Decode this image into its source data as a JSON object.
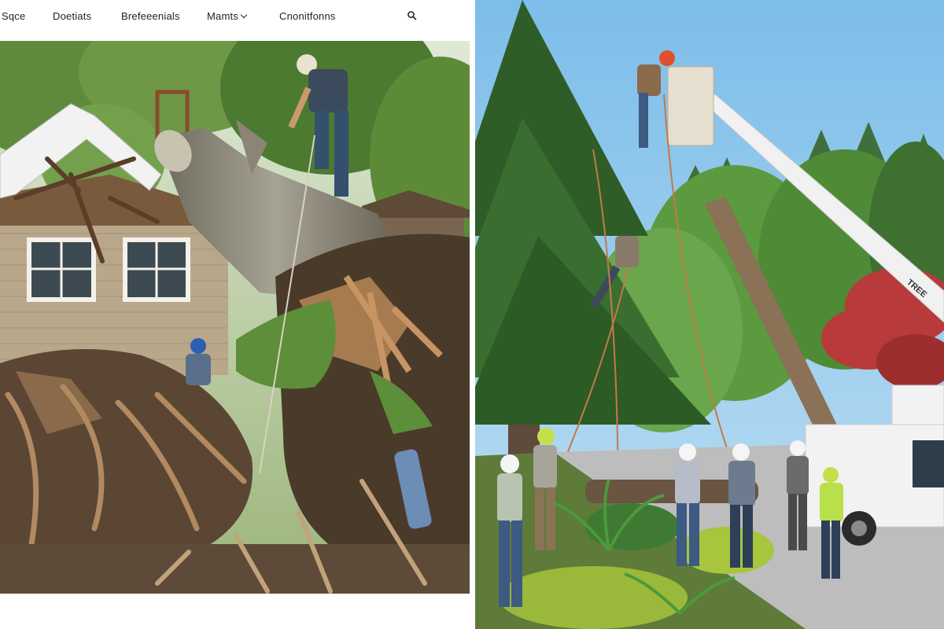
{
  "nav": {
    "logo": "Sqce",
    "items": [
      "Doetiats",
      "Brefeeenials",
      "Mamts",
      "Cnonitfonns"
    ],
    "dropdown_index": 2
  },
  "icons": {
    "search": "search-icon",
    "dropdown": "chevron-down-icon"
  },
  "colors": {
    "sky": "#8ec8ef",
    "foliage": "#4f7a33",
    "bark": "#8b7156",
    "truck_white": "#f2f2f2",
    "helmet_white": "#f5f5f5",
    "helmet_orange": "#e0502a",
    "vest_green": "#b9e04a"
  },
  "photos": {
    "left": "storm-fallen-tree-on-house",
    "right": "tree-removal-crew-with-bucket-truck"
  },
  "truck": {
    "boom_text": "TREE"
  }
}
